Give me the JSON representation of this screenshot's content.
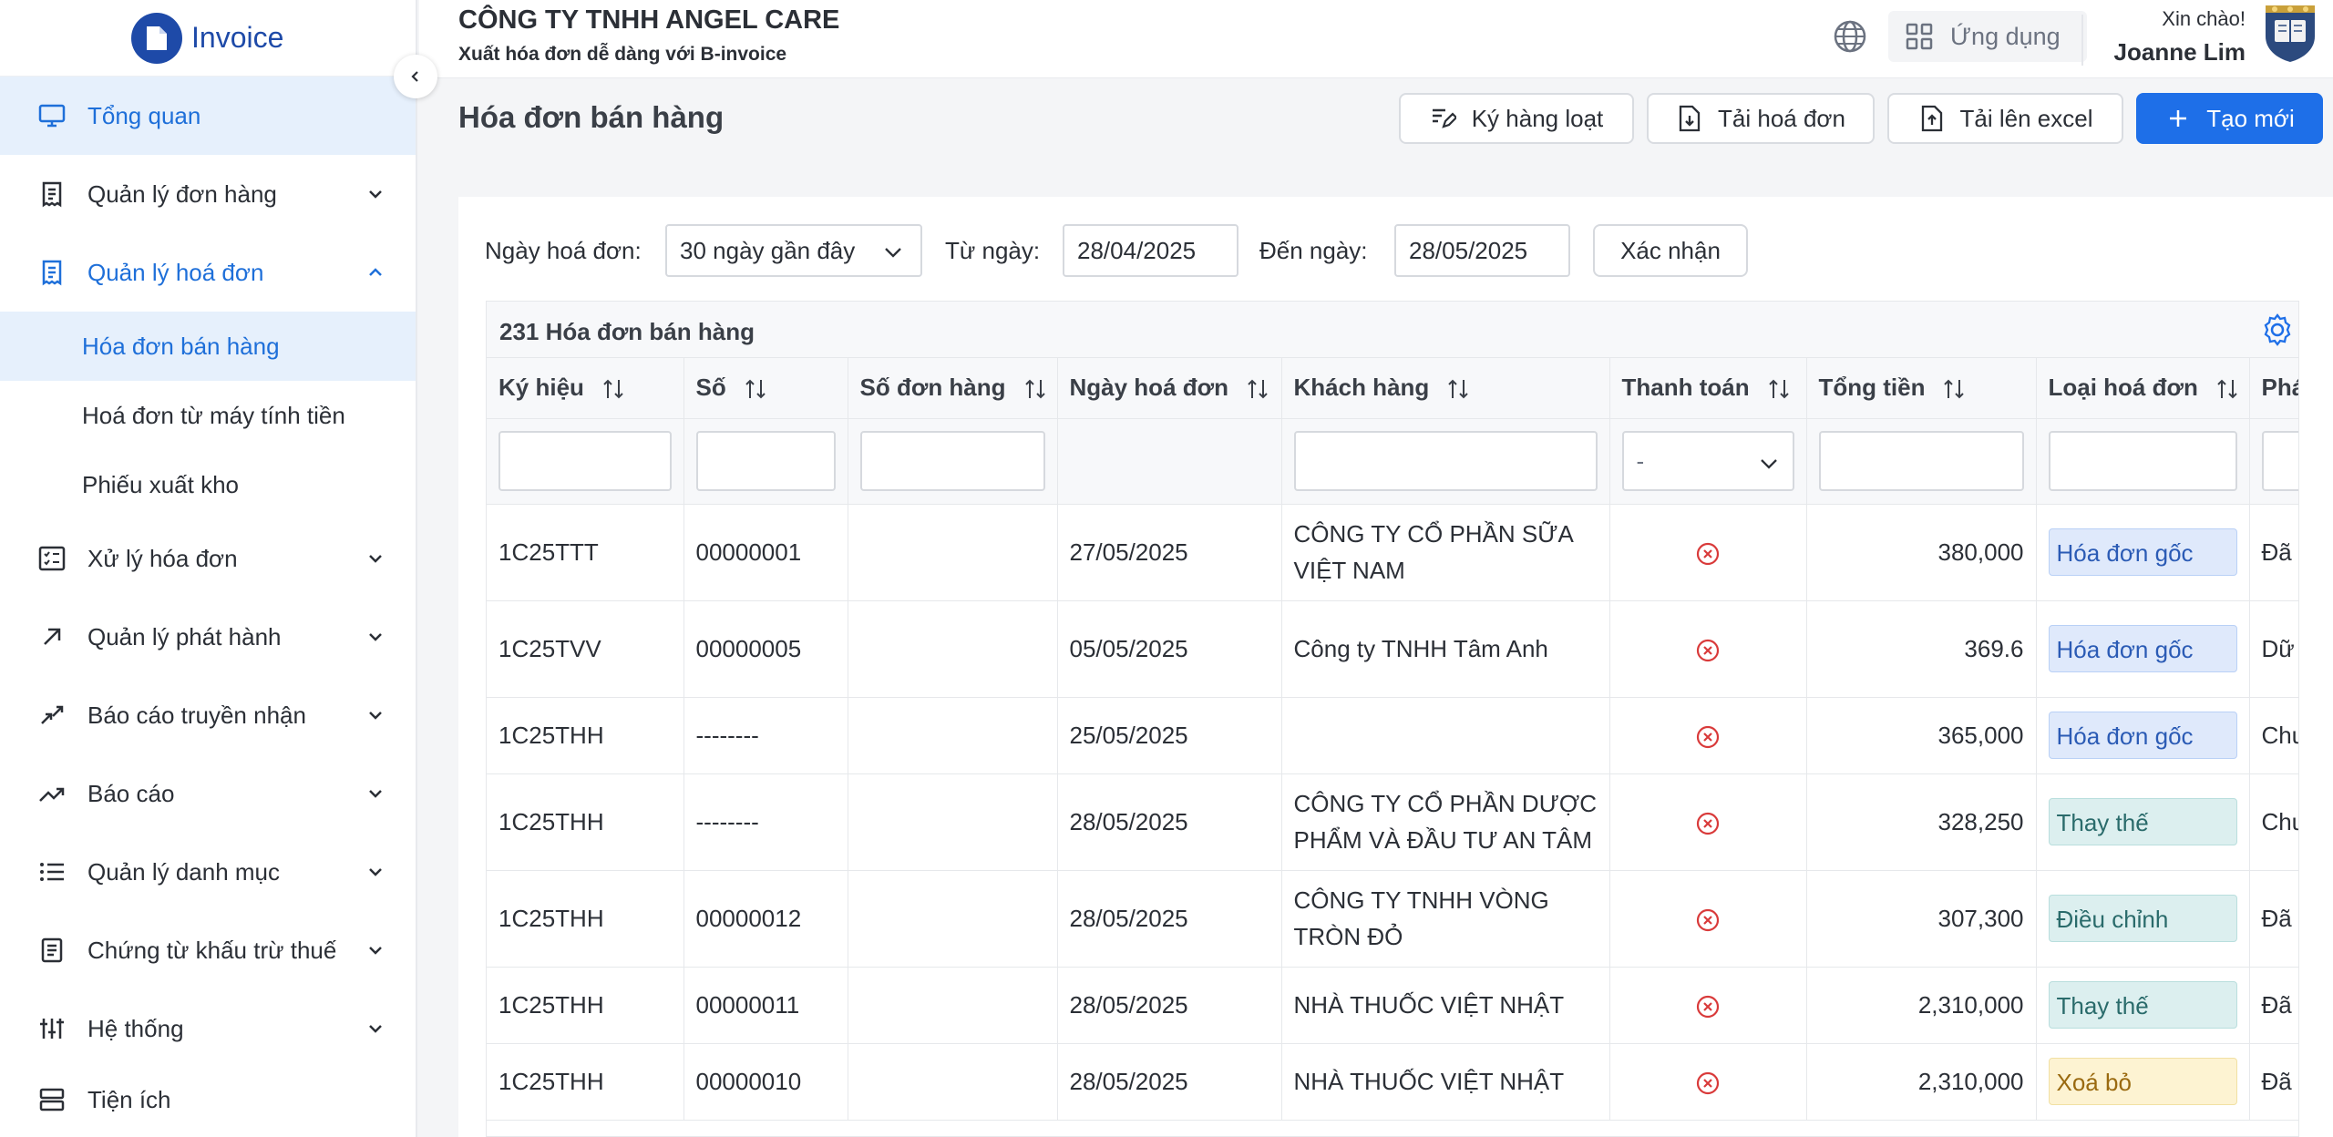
{
  "app": {
    "logo_text": "Invoice"
  },
  "header": {
    "company": "CÔNG TY TNHH ANGEL CARE",
    "tagline": "Xuất hóa đơn dễ dàng với B-invoice",
    "apps_label": "Ứng dụng",
    "greeting": "Xin chào!",
    "user_name": "Joanne Lim"
  },
  "sidebar": {
    "items": [
      {
        "label": "Tổng quan",
        "icon": "monitor-icon"
      },
      {
        "label": "Quản lý đơn hàng",
        "icon": "receipt-icon"
      },
      {
        "label": "Quản lý hoá đơn",
        "icon": "invoice-icon"
      },
      {
        "label": "Xử lý hóa đơn",
        "icon": "checklist-icon"
      },
      {
        "label": "Quản lý phát hành",
        "icon": "arrow-up-right-icon"
      },
      {
        "label": "Báo cáo truyền nhận",
        "icon": "transfer-icon"
      },
      {
        "label": "Báo cáo",
        "icon": "trend-icon"
      },
      {
        "label": "Quản lý danh mục",
        "icon": "list-icon"
      },
      {
        "label": "Chứng từ khấu trừ thuế",
        "icon": "document-icon"
      },
      {
        "label": "Hệ thống",
        "icon": "sliders-icon"
      },
      {
        "label": "Tiện ích",
        "icon": "server-icon"
      }
    ],
    "sub_items": [
      {
        "label": "Hóa đơn bán hàng"
      },
      {
        "label": "Hoá đơn từ máy tính tiền"
      },
      {
        "label": "Phiếu xuất kho"
      }
    ]
  },
  "page": {
    "title": "Hóa đơn bán hàng",
    "actions": {
      "bulk_sign": "Ký hàng loạt",
      "download": "Tải hoá đơn",
      "upload_excel": "Tải lên excel",
      "create": "Tạo mới"
    }
  },
  "filters": {
    "date_label": "Ngày hoá đơn:",
    "date_range_value": "30 ngày gần đây",
    "from_label": "Từ ngày:",
    "from_value": "28/04/2025",
    "to_label": "Đến ngày:",
    "to_value": "28/05/2025",
    "confirm": "Xác nhận"
  },
  "table": {
    "count_text": "231 Hóa đơn bán hàng",
    "columns": [
      "Ký hiệu",
      "Số",
      "Số đơn hàng",
      "Ngày hoá đơn",
      "Khách hàng",
      "Thanh toán",
      "Tổng tiền",
      "Loại hoá đơn",
      "Phá"
    ],
    "payment_filter_value": "-",
    "rows": [
      {
        "symbol": "1C25TTT",
        "number": "00000001",
        "order": "",
        "date": "27/05/2025",
        "customer": "CÔNG TY CỔ PHẦN SỮA VIỆT NAM",
        "total": "380,000",
        "type": "Hóa đơn gốc",
        "type_color": "blue",
        "status": "Đã"
      },
      {
        "symbol": "1C25TVV",
        "number": "00000005",
        "order": "",
        "date": "05/05/2025",
        "customer": "Công ty TNHH Tâm Anh",
        "total": "369.6",
        "type": "Hóa đơn gốc",
        "type_color": "blue",
        "status": "Dữ lệ"
      },
      {
        "symbol": "1C25THH",
        "number": "--------",
        "order": "",
        "date": "25/05/2025",
        "customer": "",
        "total": "365,000",
        "type": "Hóa đơn gốc",
        "type_color": "blue",
        "status": "Chu"
      },
      {
        "symbol": "1C25THH",
        "number": "--------",
        "order": "",
        "date": "28/05/2025",
        "customer": "CÔNG TY CỔ PHẦN DƯỢC PHẨM VÀ ĐẦU TƯ AN TÂM",
        "total": "328,250",
        "type": "Thay thế",
        "type_color": "teal",
        "status": "Chu"
      },
      {
        "symbol": "1C25THH",
        "number": "00000012",
        "order": "",
        "date": "28/05/2025",
        "customer": "CÔNG TY TNHH VÒNG TRÒN ĐỎ",
        "total": "307,300",
        "type": "Điều chỉnh",
        "type_color": "teal",
        "status": "Đã"
      },
      {
        "symbol": "1C25THH",
        "number": "00000011",
        "order": "",
        "date": "28/05/2025",
        "customer": "NHÀ THUỐC VIỆT NHẬT",
        "total": "2,310,000",
        "type": "Thay thế",
        "type_color": "teal",
        "status": "Đã"
      },
      {
        "symbol": "1C25THH",
        "number": "00000010",
        "order": "",
        "date": "28/05/2025",
        "customer": "NHÀ THUỐC VIỆT NHẬT",
        "total": "2,310,000",
        "type": "Xoá bỏ",
        "type_color": "yellow",
        "status": "Đã"
      }
    ]
  },
  "colors": {
    "primary": "#1e6fe8",
    "brand": "#1e4aa8",
    "active_bg": "#e6f0fc",
    "error": "#d93a3a"
  }
}
